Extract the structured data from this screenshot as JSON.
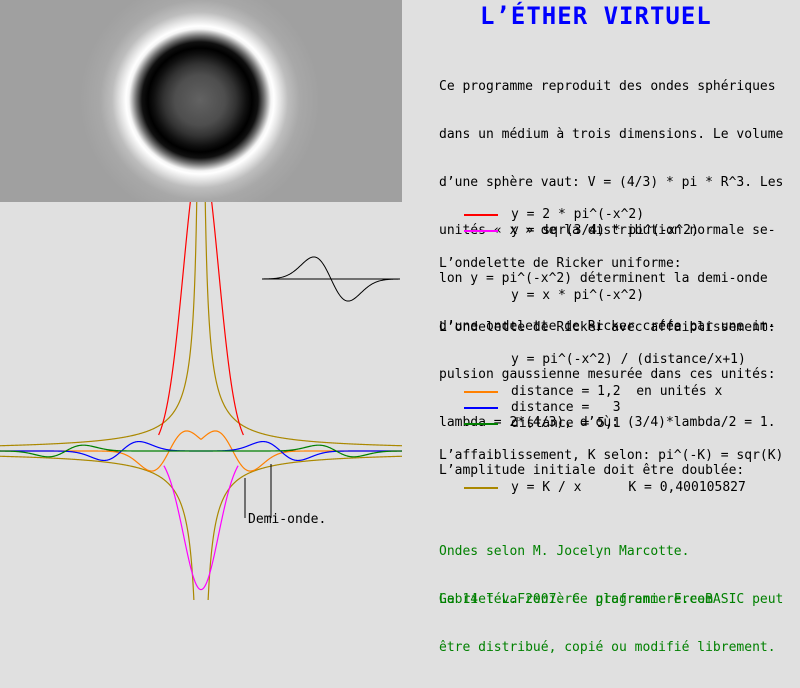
{
  "title": "L’ÉTHER VIRTUEL",
  "intro_lines": [
    "Ce programme reproduit des ondes sphériques",
    "dans un médium à trois dimensions. Le volume",
    "d’une sphère vaut: V = (4/3) * pi * R^3. Les",
    "unités « x » de la distribution normale se-",
    "lon y = pi^(-x^2) déterminent la demi-onde",
    "d’une ondelette de Ricker créée par une im-",
    "pulsion gaussienne mesurée dans ces unités:",
    "lambda = 2*(4/3), d’où: (3/4)*lambda/2 = 1.",
    "L’amplitude initiale doit être doublée:"
  ],
  "legend_top": [
    {
      "label": "y = 2 * pi^(-x^2)",
      "color": "#ff0000"
    },
    {
      "label": "y = sqr(3/4) * pi^(-x^2)",
      "color": "#ff00ff"
    }
  ],
  "ricker_uniform_label": "L’ondelette de Ricker uniforme:",
  "ricker_uniform_eq": "y = x * pi^(-x^2)",
  "ricker_damped_label": "L’ondelette de Ricker avec affaiblissement:",
  "ricker_damped_eq": "y = pi^(-x^2) / (distance/x+1)",
  "legend_distance": [
    {
      "label": "distance = 1,2  en unités x",
      "color": "#ff8000"
    },
    {
      "label": "distance =   3",
      "color": "#0000ff"
    },
    {
      "label": "distance = 5,1",
      "color": "#008000"
    }
  ],
  "k_label": "L’affaiblissement, K selon: pi^(-K) = sqr(K)",
  "k_legend": {
    "label": "y = K / x      K = 0,400105827",
    "color": "#aa8800"
  },
  "credits": [
    "Ondes selon M. Jocelyn Marcotte.",
    "Gabriel LaFrenière  glafreniere.com"
  ],
  "license": [
    "Le 14 fév. 2007. Ce programme FreeBASIC peut",
    "être distribué, copié ou modifié librement."
  ],
  "demi_onde_label": "Demi-onde.",
  "chart_data": {
    "type": "line",
    "K": 0.400105827,
    "series": [
      {
        "formula": "2*pi^(-x^2)",
        "color": "#ff0000"
      },
      {
        "formula": "sqr(3/4)*pi^(-x^2)",
        "color": "#ff00ff"
      },
      {
        "formula": "Ricker damped, distance 1.2",
        "distance": 1.2,
        "color": "#ff8000"
      },
      {
        "formula": "Ricker damped, distance 3",
        "distance": 3,
        "color": "#0000ff"
      },
      {
        "formula": "Ricker damped, distance 5.1",
        "distance": 5.1,
        "color": "#008000"
      },
      {
        "formula": "K/x",
        "color": "#aa8800"
      }
    ]
  }
}
